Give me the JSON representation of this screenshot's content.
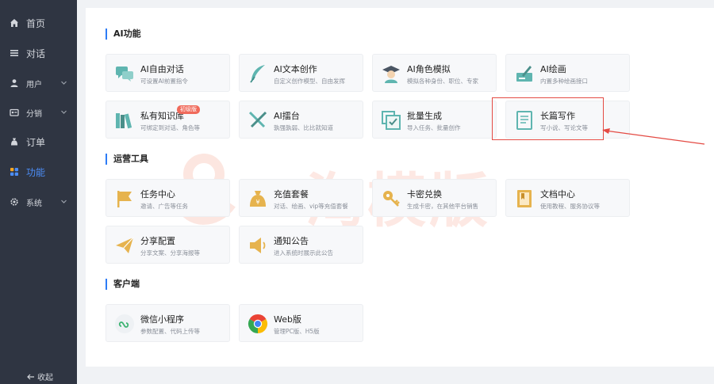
{
  "sidebar": {
    "items": [
      {
        "label": "首页",
        "icon": "home-icon"
      },
      {
        "label": "对话",
        "icon": "menu-icon"
      },
      {
        "label": "用户",
        "icon": "user-icon"
      },
      {
        "label": "分销",
        "icon": "distribution-icon"
      },
      {
        "label": "订单",
        "icon": "bag-icon"
      },
      {
        "label": "功能",
        "icon": "grid-icon"
      },
      {
        "label": "系统",
        "icon": "gear-icon"
      }
    ],
    "collapse_label": "收起",
    "active_color": "#4c8df6"
  },
  "sections": {
    "ai": {
      "title": "AI功能",
      "cards": [
        {
          "title": "AI自由对话",
          "desc": "可设置AI前置指令",
          "icon": "chat-bubbles-icon"
        },
        {
          "title": "AI文本创作",
          "desc": "自定义创作模型、自由发挥",
          "icon": "feather-icon"
        },
        {
          "title": "AI角色模拟",
          "desc": "模拟各种身份、职位、专家",
          "icon": "graduate-icon"
        },
        {
          "title": "AI绘画",
          "desc": "内置多种绘画接口",
          "icon": "palette-icon"
        },
        {
          "title": "私有知识库",
          "desc": "可绑定到对话、角色等",
          "icon": "books-icon",
          "badge": "初级版"
        },
        {
          "title": "AI擂台",
          "desc": "孰强孰弱、比比就知道",
          "icon": "crossed-swords-icon"
        },
        {
          "title": "批量生成",
          "desc": "导入任务、批量创作",
          "icon": "batch-check-icon"
        },
        {
          "title": "长篇写作",
          "desc": "写小说、写论文等",
          "icon": "notebook-icon"
        }
      ]
    },
    "ops": {
      "title": "运营工具",
      "cards": [
        {
          "title": "任务中心",
          "desc": "邀请、广告等任务",
          "icon": "flag-icon"
        },
        {
          "title": "充值套餐",
          "desc": "对话、绘画、vip等充值套餐",
          "icon": "money-bag-icon"
        },
        {
          "title": "卡密兑换",
          "desc": "生成卡密，在其他平台销售",
          "icon": "key-icon"
        },
        {
          "title": "文档中心",
          "desc": "使用教程、服务协议等",
          "icon": "document-icon"
        },
        {
          "title": "分享配置",
          "desc": "分享文案、分享海报等",
          "icon": "paper-plane-icon"
        },
        {
          "title": "通知公告",
          "desc": "进入系统时展示此公告",
          "icon": "speaker-icon"
        }
      ]
    },
    "client": {
      "title": "客户端",
      "cards": [
        {
          "title": "微信小程序",
          "desc": "参数配置、代码上传等",
          "icon": "mini-program-icon"
        },
        {
          "title": "Web版",
          "desc": "管理PC版、H5版",
          "icon": "chrome-icon"
        }
      ]
    }
  },
  "watermark": {
    "text": "一淘模版",
    "color": "#f28264"
  },
  "colors": {
    "sidebar_bg": "#2f3542",
    "accent": "#2d7cf6",
    "highlight": "#e44b44",
    "icon_teal": "#5fb5b0",
    "icon_gold": "#e6b34e"
  }
}
